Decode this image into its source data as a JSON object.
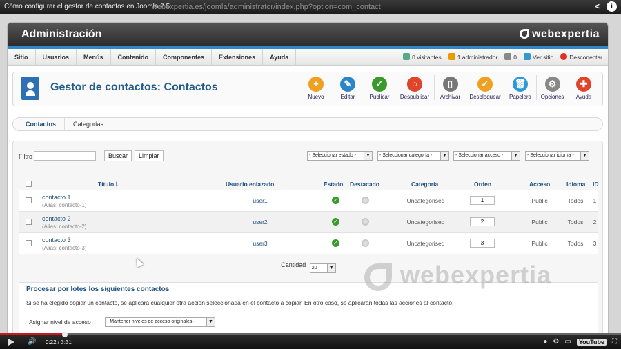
{
  "video": {
    "title": "Cómo configurar el gestor de contactos en Joomla 2.5",
    "url_ghost": "webexpertia.es/joomla/administrator/index.php?option=com_contact",
    "current_time": "0:22",
    "duration": "3:31",
    "progress": 0.104,
    "logo": "YouTube"
  },
  "admin": {
    "title": "Administración",
    "brand": "webexpertia",
    "menu": [
      "Sitio",
      "Usuarios",
      "Menús",
      "Contenido",
      "Componentes",
      "Extensiones",
      "Ayuda"
    ],
    "status": {
      "visitors": "0 visitantes",
      "admins": "1 administrador",
      "messages": "0",
      "view_site": "Ver sitio",
      "logout": "Desconectar"
    }
  },
  "page": {
    "title": "Gestor de contactos: Contactos",
    "toolbar": [
      {
        "label": "Nuevo",
        "color": "#f0a020",
        "glyph": "+"
      },
      {
        "label": "Editar",
        "color": "#2a86c8",
        "glyph": "✎"
      },
      {
        "label": "Publicar",
        "color": "#3a9a2b",
        "glyph": "✓"
      },
      {
        "label": "Despublicar",
        "color": "#e0452b",
        "glyph": "○"
      },
      {
        "label": "Archivar",
        "color": "#777777",
        "glyph": "▯"
      },
      {
        "label": "Desbloquear",
        "color": "#f0a020",
        "glyph": "✓"
      },
      {
        "label": "Papelera",
        "color": "#2a9ad8",
        "glyph": "🗑"
      },
      {
        "label": "Opciones",
        "color": "#888888",
        "glyph": "⚙"
      },
      {
        "label": "Ayuda",
        "color": "#e0452b",
        "glyph": "✚"
      }
    ],
    "tabs": [
      "Contactos",
      "Categorías"
    ]
  },
  "filters": {
    "label": "Filtro",
    "search_button": "Buscar",
    "clear_button": "Limpiar",
    "state": "- Seleccionar estado -",
    "category": "- Seleccionar categoría -",
    "access": "- Seleccionar acceso -",
    "language": "- Seleccionar idioma -"
  },
  "table": {
    "columns": [
      "Título",
      "Usuario enlazado",
      "Estado",
      "Destacado",
      "Categoría",
      "Orden",
      "Acceso",
      "Idioma",
      "ID"
    ],
    "rows": [
      {
        "name": "contacto 1",
        "alias": "(Alias: contacto-1)",
        "user": "user1",
        "category": "Uncategorised",
        "order": "1",
        "access": "Public",
        "language": "Todos",
        "id": "1"
      },
      {
        "name": "contacto 2",
        "alias": "(Alias: contacto-2)",
        "user": "user2",
        "category": "Uncategorised",
        "order": "2",
        "access": "Public",
        "language": "Todos",
        "id": "2"
      },
      {
        "name": "contacto 3",
        "alias": "(Alias: contacto-3)",
        "user": "user3",
        "category": "Uncategorised",
        "order": "3",
        "access": "Public",
        "language": "Todos",
        "id": "3"
      }
    ],
    "count_label": "Cantidad",
    "count_value": "20"
  },
  "batch": {
    "title": "Procesar por lotes los siguientes contactos",
    "description": "Si se ha elegido copiar un contacto, se aplicará cualquier otra acción seleccionada en el contacto a copiar. En otro caso, se aplicarán todas las acciones al contacto.",
    "access_label": "Asignar nivel de acceso",
    "access_value": "- Mantener niveles de acceso originales -"
  },
  "watermark": "webexpertia"
}
